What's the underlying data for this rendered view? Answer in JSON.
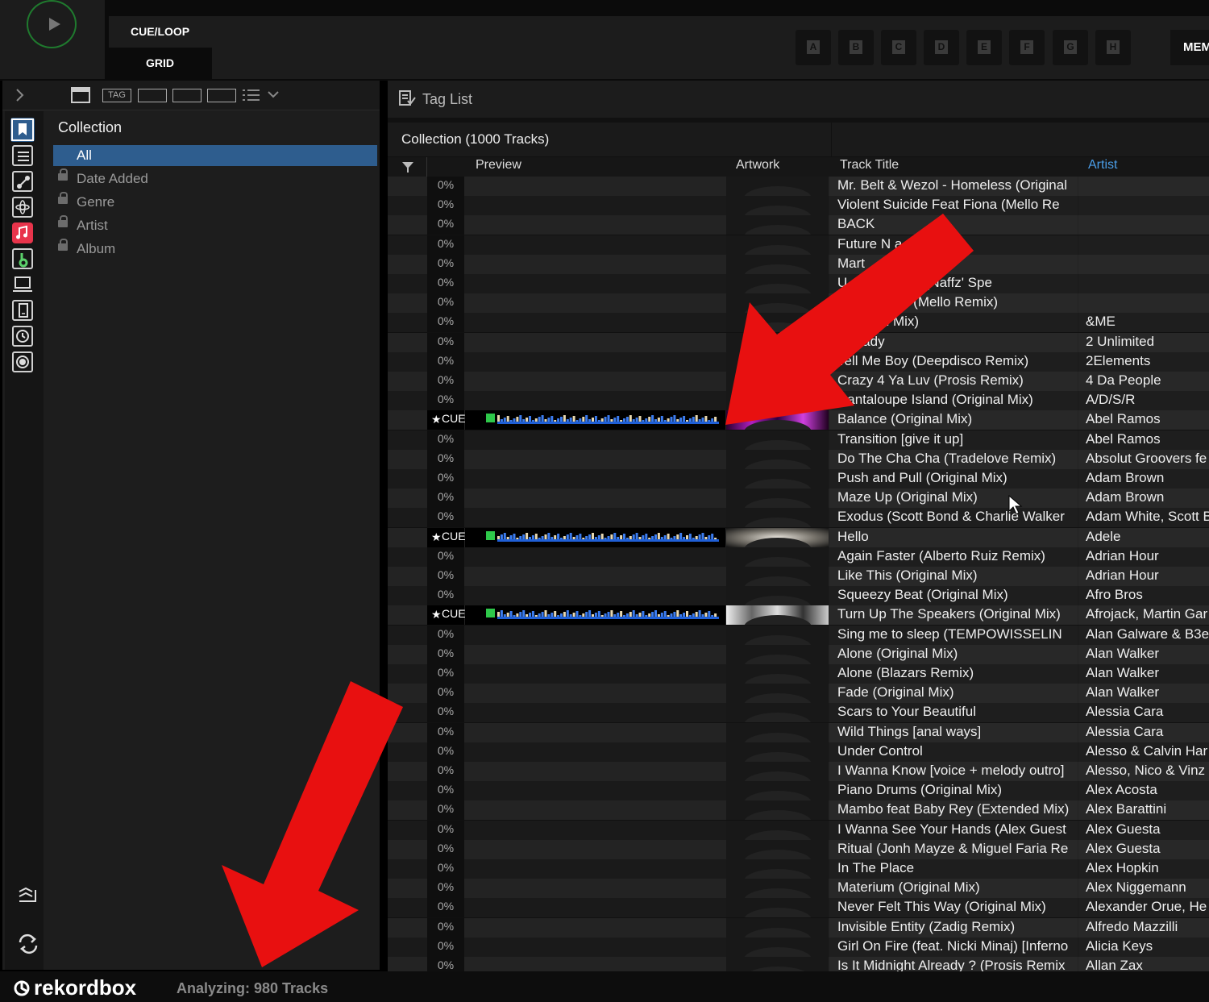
{
  "header": {
    "cue_loop_label": "CUE/LOOP",
    "grid_label": "GRID",
    "hotcues": [
      "A",
      "B",
      "C",
      "D",
      "E",
      "F",
      "G",
      "H"
    ],
    "mem_label": "MEM"
  },
  "toolbar": {
    "tag_label": "TAG"
  },
  "tree": {
    "title": "Collection",
    "items": [
      {
        "label": "All",
        "selected": true,
        "locked": false
      },
      {
        "label": "Date Added",
        "selected": false,
        "locked": true
      },
      {
        "label": "Genre",
        "selected": false,
        "locked": true
      },
      {
        "label": "Artist",
        "selected": false,
        "locked": true
      },
      {
        "label": "Album",
        "selected": false,
        "locked": true
      }
    ]
  },
  "tag_list": {
    "label": "Tag List"
  },
  "collection": {
    "heading": "Collection (1000 Tracks)",
    "columns": {
      "preview": "Preview",
      "artwork": "Artwork",
      "title": "Track Title",
      "artist": "Artist"
    },
    "rows": [
      {
        "pct": "0%",
        "title": "Mr. Belt & Wezol - Homeless (Original",
        "artist": ""
      },
      {
        "pct": "0%",
        "title": "Violent Suicide Feat Fiona (Mello Re",
        "artist": ""
      },
      {
        "pct": "0%",
        "title": "BACK",
        "artist": ""
      },
      {
        "pct": "0%",
        "title": "Future N        a - Poison",
        "artist": ""
      },
      {
        "pct": "0%",
        "title": "Mart",
        "artist": ""
      },
      {
        "pct": "0%",
        "title": "U         - Casanova (Naffz' Spe",
        "artist": ""
      },
      {
        "pct": "0%",
        "title": "           - The Cold - (Mello Remix)",
        "artist": ""
      },
      {
        "pct": "0%",
        "title": "      (Original Mix)",
        "artist": "&ME"
      },
      {
        "pct": "0%",
        "title": "     t Ready",
        "artist": "2 Unlimited"
      },
      {
        "pct": "0%",
        "title": "Tell Me Boy (Deepdisco Remix)",
        "artist": "2Elements"
      },
      {
        "pct": "0%",
        "title": "Crazy 4 Ya Luv (Prosis Remix)",
        "artist": "4 Da People"
      },
      {
        "pct": "0%",
        "title": "Cantaloupe Island (Original Mix)",
        "artist": "A/D/S/R"
      },
      {
        "pct": "CUE",
        "title": "Balance (Original Mix)",
        "artist": "Abel Ramos",
        "analyzed": true
      },
      {
        "pct": "0%",
        "title": "Transition [give it up]",
        "artist": "Abel Ramos"
      },
      {
        "pct": "0%",
        "title": "Do The Cha Cha (Tradelove Remix)",
        "artist": "Absolut Groovers fe"
      },
      {
        "pct": "0%",
        "title": "Push and Pull (Original Mix)",
        "artist": "Adam Brown"
      },
      {
        "pct": "0%",
        "title": "Maze Up (Original Mix)",
        "artist": "Adam Brown"
      },
      {
        "pct": "0%",
        "title": "Exodus (Scott Bond & Charlie Walker",
        "artist": "Adam White, Scott B"
      },
      {
        "pct": "CUE",
        "title": "Hello",
        "artist": "Adele",
        "analyzed": true
      },
      {
        "pct": "0%",
        "title": "Again Faster (Alberto Ruiz Remix)",
        "artist": "Adrian Hour"
      },
      {
        "pct": "0%",
        "title": "Like This (Original Mix)",
        "artist": "Adrian Hour"
      },
      {
        "pct": "0%",
        "title": "Squeezy Beat (Original Mix)",
        "artist": "Afro Bros"
      },
      {
        "pct": "CUE",
        "title": "Turn Up The Speakers (Original Mix)",
        "artist": "Afrojack, Martin Gar",
        "analyzed": true
      },
      {
        "pct": "0%",
        "title": "Sing me to sleep (TEMPOWISSELIN",
        "artist": "Alan Galware & B3e"
      },
      {
        "pct": "0%",
        "title": "Alone (Original Mix)",
        "artist": "Alan Walker"
      },
      {
        "pct": "0%",
        "title": "Alone (Blazars Remix)",
        "artist": "Alan Walker"
      },
      {
        "pct": "0%",
        "title": "Fade (Original Mix)",
        "artist": "Alan Walker"
      },
      {
        "pct": "0%",
        "title": "Scars to Your Beautiful",
        "artist": "Alessia Cara"
      },
      {
        "pct": "0%",
        "title": "Wild Things [anal ways]",
        "artist": "Alessia Cara"
      },
      {
        "pct": "0%",
        "title": "Under Control",
        "artist": "Alesso & Calvin Har"
      },
      {
        "pct": "0%",
        "title": "I Wanna Know [voice + melody outro]",
        "artist": "Alesso, Nico & Vinz"
      },
      {
        "pct": "0%",
        "title": "Piano Drums (Original Mix)",
        "artist": "Alex Acosta"
      },
      {
        "pct": "0%",
        "title": "Mambo feat Baby Rey (Extended Mix)",
        "artist": "Alex Barattini"
      },
      {
        "pct": "0%",
        "title": "I Wanna See Your Hands (Alex Guest",
        "artist": "Alex Guesta"
      },
      {
        "pct": "0%",
        "title": "Ritual (Jonh Mayze & Miguel Faria Re",
        "artist": "Alex Guesta"
      },
      {
        "pct": "0%",
        "title": "In The Place",
        "artist": "Alex Hopkin"
      },
      {
        "pct": "0%",
        "title": "Materium (Original Mix)",
        "artist": "Alex Niggemann"
      },
      {
        "pct": "0%",
        "title": "Never Felt This Way (Original Mix)",
        "artist": "Alexander Orue, He"
      },
      {
        "pct": "0%",
        "title": "Invisible Entity (Zadig Remix)",
        "artist": "Alfredo Mazzilli"
      },
      {
        "pct": "0%",
        "title": "Girl On Fire (feat. Nicki Minaj) [Inferno",
        "artist": "Alicia Keys"
      },
      {
        "pct": "0%",
        "title": "Is It Midnight Already ? (Prosis Remix",
        "artist": "Allan Zax"
      }
    ]
  },
  "status": {
    "logo": "rekordbox",
    "analyzing": "Analyzing: 980 Tracks"
  },
  "colors": {
    "selection": "#2e5d8e",
    "artist_header": "#4a9ee8",
    "arrow": "#e81010",
    "play_ring": "#1f7a2e"
  }
}
